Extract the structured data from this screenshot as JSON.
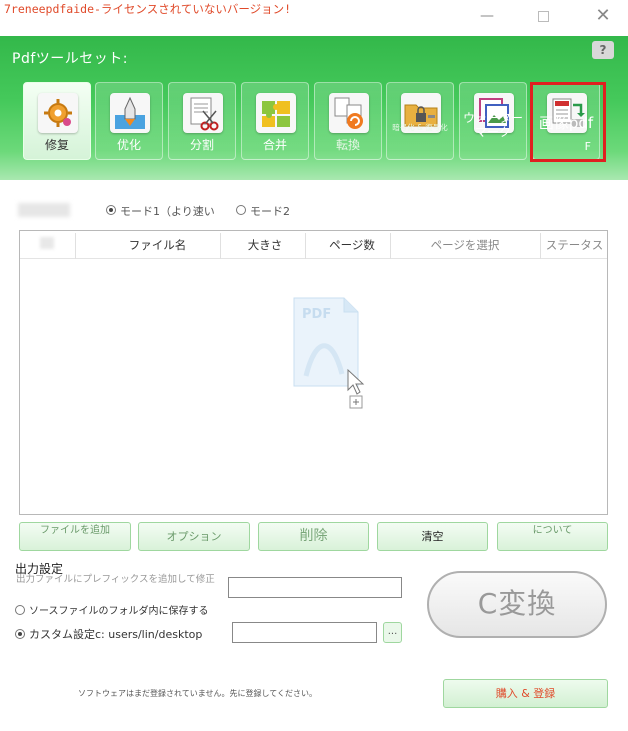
{
  "window": {
    "title": "7reneepdfaide-ライセンスされていないバージョン!",
    "minimize_glyph": "—",
    "close_glyph": "✕"
  },
  "toolbar": {
    "label": "Pdfツールセット:",
    "help_glyph": "?",
    "tools": [
      {
        "label": "修复",
        "icon": "repair-gear-icon",
        "active": true
      },
      {
        "label": "优化",
        "icon": "rocket-icon"
      },
      {
        "label": "分割",
        "icon": "scissors-icon"
      },
      {
        "label": "合并",
        "icon": "puzzle-icon"
      },
      {
        "label": "転換",
        "icon": "convert-arrows-icon"
      },
      {
        "label": "暗号化 & 復号化",
        "icon": "lock-folder-icon"
      },
      {
        "label": "ウォーターマーク",
        "icon": "picture-watermark-icon"
      },
      {
        "label": "画像pdf",
        "suffix": "F",
        "icon": "image-to-pdf-icon",
        "highlighted": true
      }
    ]
  },
  "modes": {
    "mode1": "モード1（より速い",
    "mode2": "モード2",
    "selected": "mode1"
  },
  "file_table": {
    "columns": [
      "ファイル名",
      "大きさ",
      "ページ数",
      "ページを選択",
      "ステータス"
    ],
    "rows": [],
    "empty_art": {
      "badge": "PDF",
      "icon": "add-pdf-drop-icon"
    }
  },
  "actions": {
    "add_file": "ファイルを追加",
    "options": "オプション",
    "delete": "削除",
    "clear": "清空",
    "about": "について"
  },
  "output": {
    "title": "出力設定",
    "prefix_option": "出力ファイルにプレフィックスを追加して修正",
    "prefix_value": "",
    "source_folder_option": "ソースファイルのフォルダ内に保存する",
    "custom_option": "カスタム設定c: users/lin/desktop",
    "custom_path_value": "",
    "browse_label": "...",
    "selected": "custom"
  },
  "convert_label": "C変換",
  "footer": {
    "note": "ソフトウェアはまだ登録されていません。先に登録してください。",
    "buy_register": "購入 & 登録"
  },
  "colors": {
    "band": "#45c95b",
    "title_text": "#e04a2a",
    "highlight": "#e02020"
  }
}
